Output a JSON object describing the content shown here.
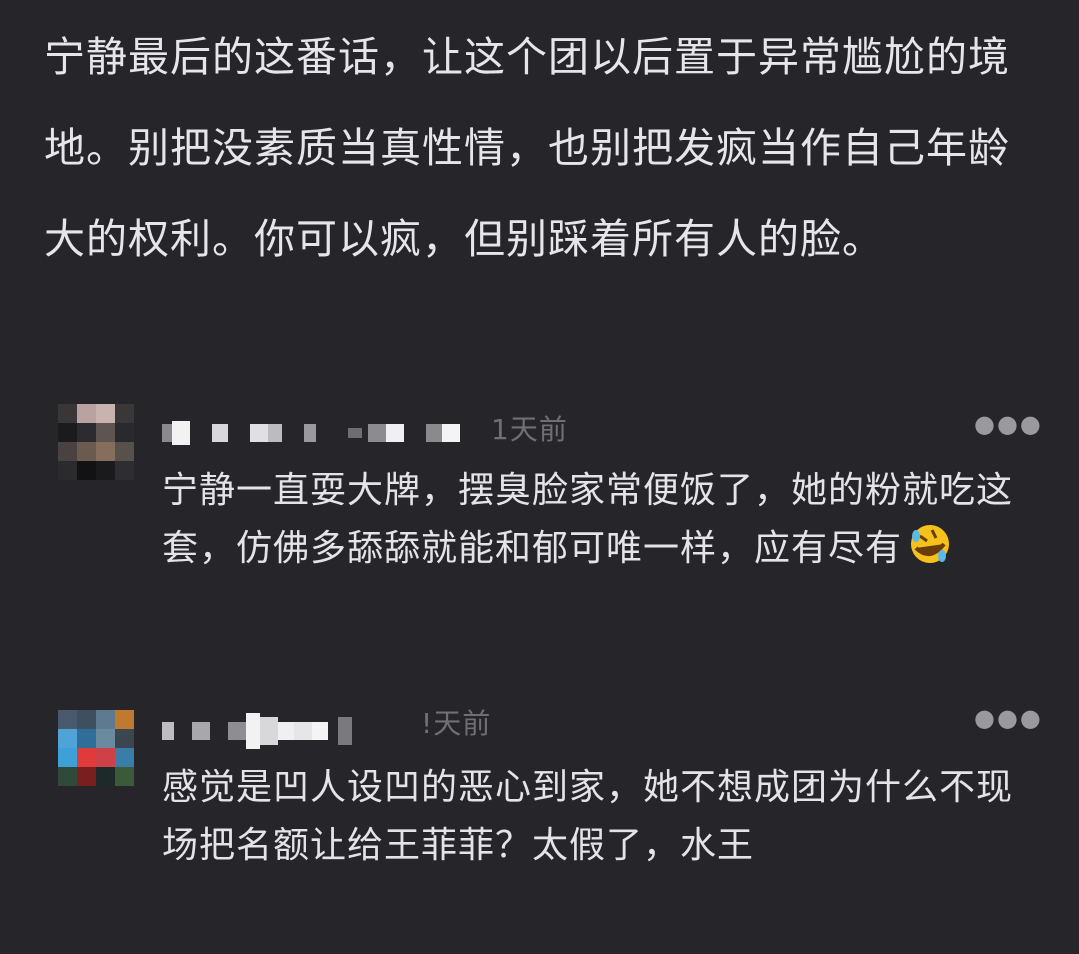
{
  "post": {
    "body": "宁静最后的这番话，让这个团以后置于异常尴尬的境地。别把没素质当真性情，也别把发疯当作自己年龄大的权利。你可以疯，但别踩着所有人的脸。"
  },
  "comments": [
    {
      "time": "1天前",
      "text": "宁静一直耍大牌，摆臭脸家常便饭了，她的粉就吃这套，仿佛多舔舔就能和郁可唯一样，应有尽有",
      "emoji": "rolling-on-floor-laughing-emoji",
      "more_icon": "more-dots-icon"
    },
    {
      "time": "!天前",
      "text": "感觉是凹人设凹的恶心到家，她不想成团为什么不现场把名额让给王菲菲？太假了，水王",
      "more_icon": "more-dots-icon"
    }
  ],
  "colors": {
    "background": "#26252a",
    "text": "#e4e4e6",
    "muted": "#707074"
  }
}
